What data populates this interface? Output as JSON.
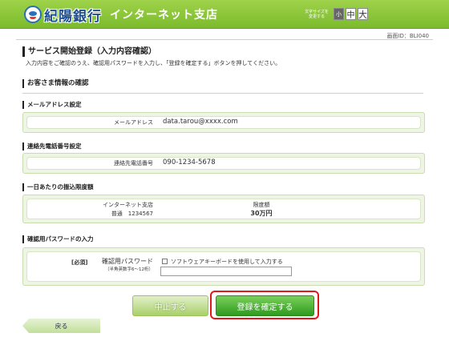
{
  "header": {
    "bank_name": "紀陽銀行",
    "branch_name": "インターネット支店",
    "fontsize_label": "文字サイズを変更する",
    "fontsize_small": "小",
    "fontsize_mid": "中",
    "fontsize_large": "大"
  },
  "screen_id": "画面ID：BLI040",
  "page": {
    "title": "サービス開始登録（入力内容確認）",
    "instruction": "入力内容をご確認のうえ、確認用パスワードを入力し、「登録を確定する」ボタンを押してください。"
  },
  "customer_section": {
    "title": "お客さま情報の確認"
  },
  "email": {
    "title": "メールアドレス設定",
    "label": "メールアドレス",
    "value": "data.tarou@xxxx.com"
  },
  "phone": {
    "title": "連絡先電話番号設定",
    "label": "連絡先電話番号",
    "value": "090-1234-5678"
  },
  "limit": {
    "title": "一日あたりの振込限度額",
    "branch": "インターネット支店",
    "account": "普通　1234567",
    "amount_label": "限度額",
    "amount_value": "30万円"
  },
  "password": {
    "title": "確認用パスワードの入力",
    "required": "[必須]",
    "label": "確認用パスワード",
    "hint": "（半角英数字6～12桁）",
    "keyboard_option": "ソフトウェアキーボードを使用して入力する",
    "input_value": ""
  },
  "buttons": {
    "cancel": "中止する",
    "confirm": "登録を確定する",
    "back": "戻る"
  }
}
